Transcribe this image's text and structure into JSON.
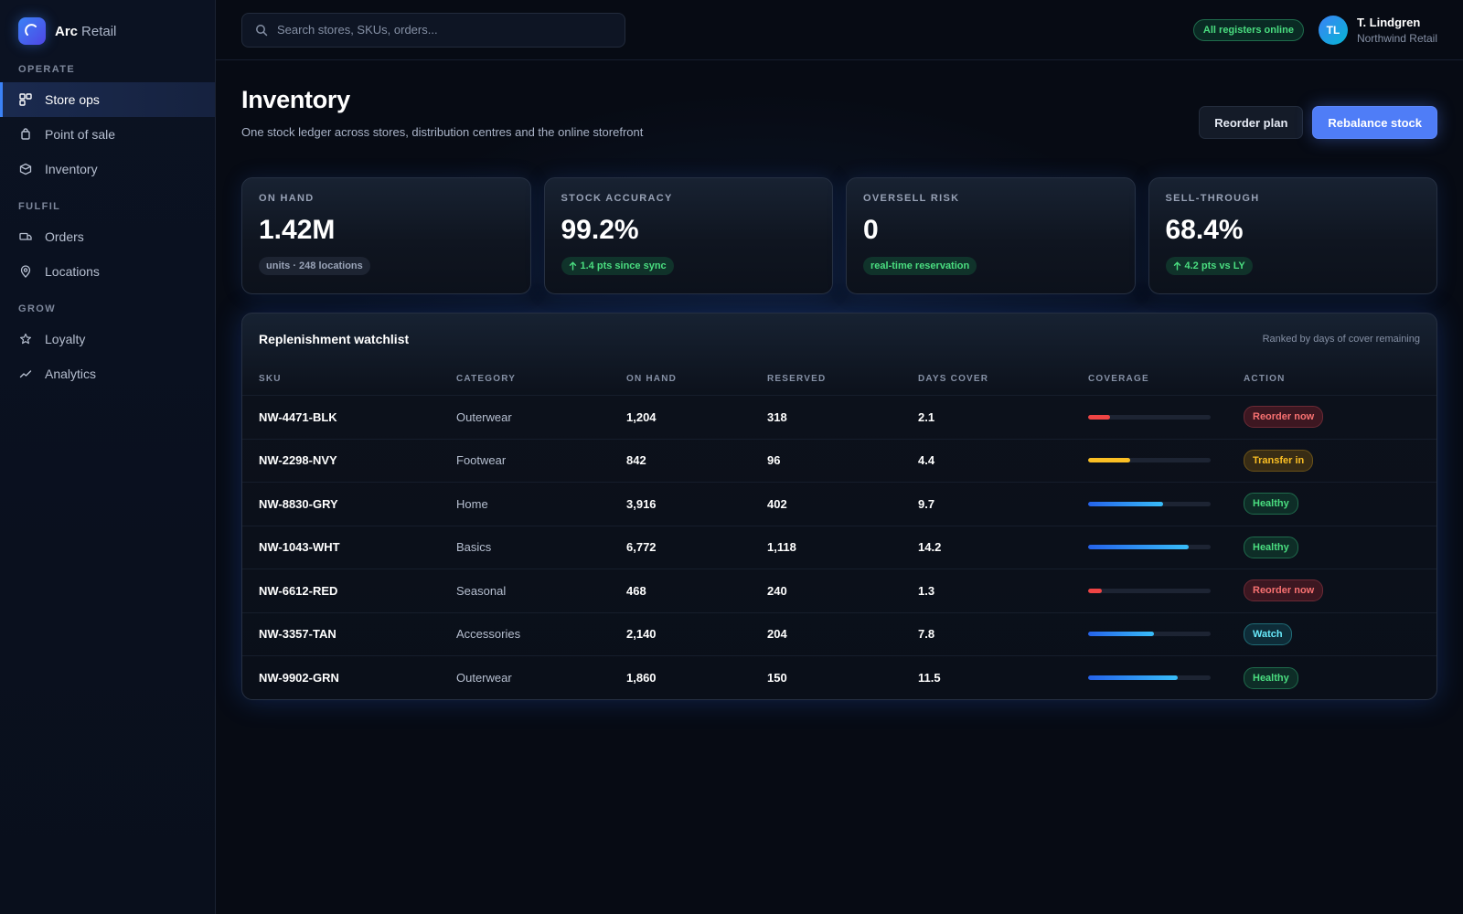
{
  "brand": {
    "name": "Arc",
    "suffix": "Retail"
  },
  "sidebar": {
    "sections": [
      {
        "title": "OPERATE",
        "items": [
          {
            "label": "Store ops",
            "icon": "store-ops-icon",
            "active": true
          },
          {
            "label": "Point of sale",
            "icon": "bag-icon",
            "active": false
          },
          {
            "label": "Inventory",
            "icon": "box-icon",
            "active": false
          }
        ]
      },
      {
        "title": "FULFIL",
        "items": [
          {
            "label": "Orders",
            "icon": "truck-icon",
            "active": false
          },
          {
            "label": "Locations",
            "icon": "map-pin-icon",
            "active": false
          }
        ]
      },
      {
        "title": "GROW",
        "items": [
          {
            "label": "Loyalty",
            "icon": "star-icon",
            "active": false
          },
          {
            "label": "Analytics",
            "icon": "trend-icon",
            "active": false
          }
        ]
      }
    ]
  },
  "topbar": {
    "search_placeholder": "Search stores, SKUs, orders...",
    "status": "All registers online",
    "user": {
      "initials": "TL",
      "name": "T. Lindgren",
      "org": "Northwind Retail"
    }
  },
  "page": {
    "title": "Inventory",
    "subtitle": "One stock ledger across stores, distribution centres and the online storefront",
    "actions": {
      "secondary": "Reorder plan",
      "primary": "Rebalance stock"
    }
  },
  "kpis": [
    {
      "label": "ON HAND",
      "value": "1.42M",
      "chip": "units · 248 locations",
      "chip_style": "neutral",
      "arrow": false
    },
    {
      "label": "STOCK ACCURACY",
      "value": "99.2%",
      "chip": "1.4 pts since sync",
      "chip_style": "green",
      "arrow": true
    },
    {
      "label": "OVERSELL RISK",
      "value": "0",
      "chip": "real-time reservation",
      "chip_style": "green",
      "arrow": false
    },
    {
      "label": "SELL-THROUGH",
      "value": "68.4%",
      "chip": "4.2 pts vs LY",
      "chip_style": "green",
      "arrow": true
    }
  ],
  "watchlist": {
    "title": "Replenishment watchlist",
    "note": "Ranked by days of cover remaining",
    "columns": [
      "SKU",
      "CATEGORY",
      "ON HAND",
      "RESERVED",
      "DAYS COVER",
      "COVERAGE",
      "ACTION"
    ],
    "rows": [
      {
        "sku": "NW-4471-BLK",
        "category": "Outerwear",
        "on_hand": "1,204",
        "reserved": "318",
        "days_cover": "2.1",
        "coverage": 0.18,
        "tone": "red",
        "action": "Reorder now"
      },
      {
        "sku": "NW-2298-NVY",
        "category": "Footwear",
        "on_hand": "842",
        "reserved": "96",
        "days_cover": "4.4",
        "coverage": 0.34,
        "tone": "amber",
        "action": "Transfer in"
      },
      {
        "sku": "NW-8830-GRY",
        "category": "Home",
        "on_hand": "3,916",
        "reserved": "402",
        "days_cover": "9.7",
        "coverage": 0.61,
        "tone": "blue",
        "action": "Healthy"
      },
      {
        "sku": "NW-1043-WHT",
        "category": "Basics",
        "on_hand": "6,772",
        "reserved": "1,118",
        "days_cover": "14.2",
        "coverage": 0.82,
        "tone": "blue",
        "action": "Healthy"
      },
      {
        "sku": "NW-6612-RED",
        "category": "Seasonal",
        "on_hand": "468",
        "reserved": "240",
        "days_cover": "1.3",
        "coverage": 0.11,
        "tone": "red",
        "action": "Reorder now"
      },
      {
        "sku": "NW-3357-TAN",
        "category": "Accessories",
        "on_hand": "2,140",
        "reserved": "204",
        "days_cover": "7.8",
        "coverage": 0.54,
        "tone": "blue",
        "action": "Watch"
      },
      {
        "sku": "NW-9902-GRN",
        "category": "Outerwear",
        "on_hand": "1,860",
        "reserved": "150",
        "days_cover": "11.5",
        "coverage": 0.73,
        "tone": "blue",
        "action": "Healthy"
      }
    ]
  },
  "colors": {
    "accent": "#4f7df7",
    "red": "#ef4444",
    "amber": "#fbbf24",
    "blue_from": "#2563eb",
    "blue_to": "#38bdf8",
    "healthy": "#4ade80",
    "watch": "#67e8f9"
  }
}
